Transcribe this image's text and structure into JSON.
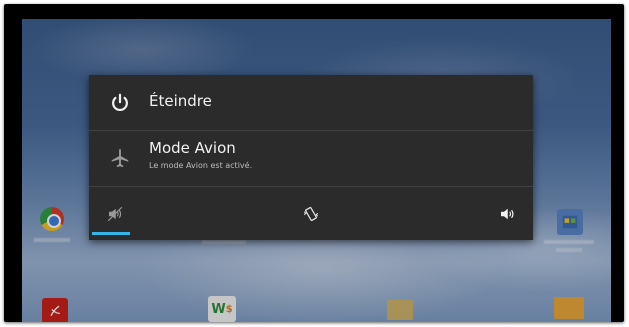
{
  "power_menu": {
    "power_off": {
      "label": "Éteindre",
      "icon": "power-icon"
    },
    "airplane_mode": {
      "label": "Mode Avion",
      "status": "Le mode Avion est activé.",
      "icon": "airplane-icon"
    },
    "sound_modes": [
      {
        "name": "silent",
        "icon": "volume-mute-icon",
        "selected": true
      },
      {
        "name": "vibrate",
        "icon": "vibrate-icon",
        "selected": false
      },
      {
        "name": "sound-on",
        "icon": "volume-on-icon",
        "selected": false
      }
    ]
  },
  "colors": {
    "dialog_bg": "#2b2b2b",
    "accent": "#33b5e5",
    "text_primary": "#f2f2f2",
    "text_secondary": "#bdbdbd"
  }
}
